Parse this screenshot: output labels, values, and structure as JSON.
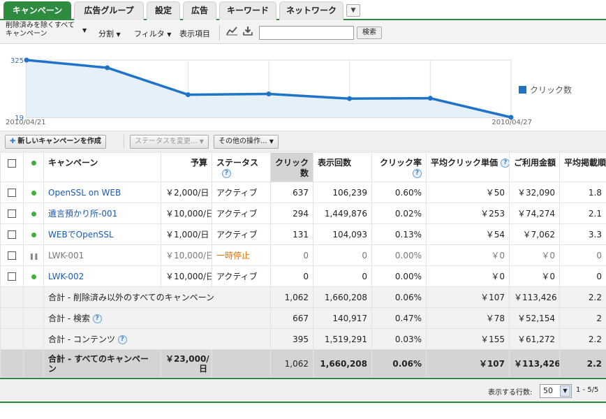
{
  "tabs": [
    {
      "label": "キャンペーン",
      "active": true
    },
    {
      "label": "広告グループ"
    },
    {
      "label": "設定"
    },
    {
      "label": "広告"
    },
    {
      "label": "キーワード"
    },
    {
      "label": "ネットワーク"
    }
  ],
  "toolbar": {
    "filter_line1": "削除済みを除くすべて",
    "filter_line2": "キャンペーン",
    "segment": "分割",
    "filter": "フィルタ",
    "columns": "表示項目",
    "search_value": "",
    "search_button": "検索"
  },
  "chart_data": {
    "type": "line",
    "series": [
      {
        "name": "クリック数",
        "color": "#1f74c8",
        "values": [
          325,
          284,
          140,
          144,
          119,
          121,
          19
        ]
      }
    ],
    "x_start_label": "2010/04/21",
    "x_end_label": "2010/04/27",
    "y_top_label": "325",
    "y_bottom_label": "19",
    "ylim": [
      19,
      325
    ],
    "grid": true,
    "legend": "right"
  },
  "actions": {
    "new_campaign": "新しいキャンペーンを作成",
    "change_status": "ステータスを変更...",
    "other_actions": "その他の操作..."
  },
  "table": {
    "headers": {
      "campaign": "キャンペーン",
      "budget": "予算",
      "status": "ステータス",
      "clicks_1": "クリック",
      "clicks_2": "数",
      "impressions": "表示回数",
      "ctr": "クリック率",
      "avg_cpc": "平均クリック単価",
      "cost": "ご利用金額",
      "avg_pos": "平均掲載順位"
    },
    "rows": [
      {
        "name": "OpenSSL on WEB",
        "budget": "￥2,000/日",
        "status": "アクティブ",
        "clicks": "637",
        "impr": "106,239",
        "ctr": "0.60%",
        "cpc": "￥50",
        "cost": "￥32,090",
        "pos": "1.8"
      },
      {
        "name": "遺言預かり所-001",
        "budget": "￥10,000/日",
        "status": "アクティブ",
        "clicks": "294",
        "impr": "1,449,876",
        "ctr": "0.02%",
        "cpc": "￥253",
        "cost": "￥74,274",
        "pos": "2.1"
      },
      {
        "name": "WEBでOpenSSL",
        "budget": "￥1,000/日",
        "status": "アクティブ",
        "clicks": "131",
        "impr": "104,093",
        "ctr": "0.13%",
        "cpc": "￥54",
        "cost": "￥7,062",
        "pos": "3.3"
      },
      {
        "name": "LWK-001",
        "budget": "￥10,000/日",
        "status": "一時停止",
        "clicks": "0",
        "impr": "0",
        "ctr": "0.00%",
        "cpc": "￥0",
        "cost": "￥0",
        "pos": "0"
      },
      {
        "name": "LWK-002",
        "budget": "￥10,000/日",
        "status": "アクティブ",
        "clicks": "0",
        "impr": "0",
        "ctr": "0.00%",
        "cpc": "￥0",
        "cost": "￥0",
        "pos": "0"
      }
    ],
    "totals": [
      {
        "label": "合計 - 削除済み以外のすべてのキャンペーン",
        "budget": "",
        "clicks": "1,062",
        "impr": "1,660,208",
        "ctr": "0.06%",
        "cpc": "￥107",
        "cost": "￥113,426",
        "pos": "2.2"
      },
      {
        "label": "合計 - 検索",
        "budget": "",
        "clicks": "667",
        "impr": "140,917",
        "ctr": "0.47%",
        "cpc": "￥78",
        "cost": "￥52,154",
        "pos": "2"
      },
      {
        "label": "合計 - コンテンツ",
        "budget": "",
        "clicks": "395",
        "impr": "1,519,291",
        "ctr": "0.03%",
        "cpc": "￥155",
        "cost": "￥61,272",
        "pos": "2.2"
      },
      {
        "label": "合計 - すべてのキャンペーン",
        "budget": "￥23,000/日",
        "clicks": "1,062",
        "impr": "1,660,208",
        "ctr": "0.06%",
        "cpc": "￥107",
        "cost": "￥113,426",
        "pos": "2.2"
      }
    ]
  },
  "footer": {
    "rows_label": "表示する行数:",
    "rows_value": "50",
    "range": "1 - 5/5"
  }
}
